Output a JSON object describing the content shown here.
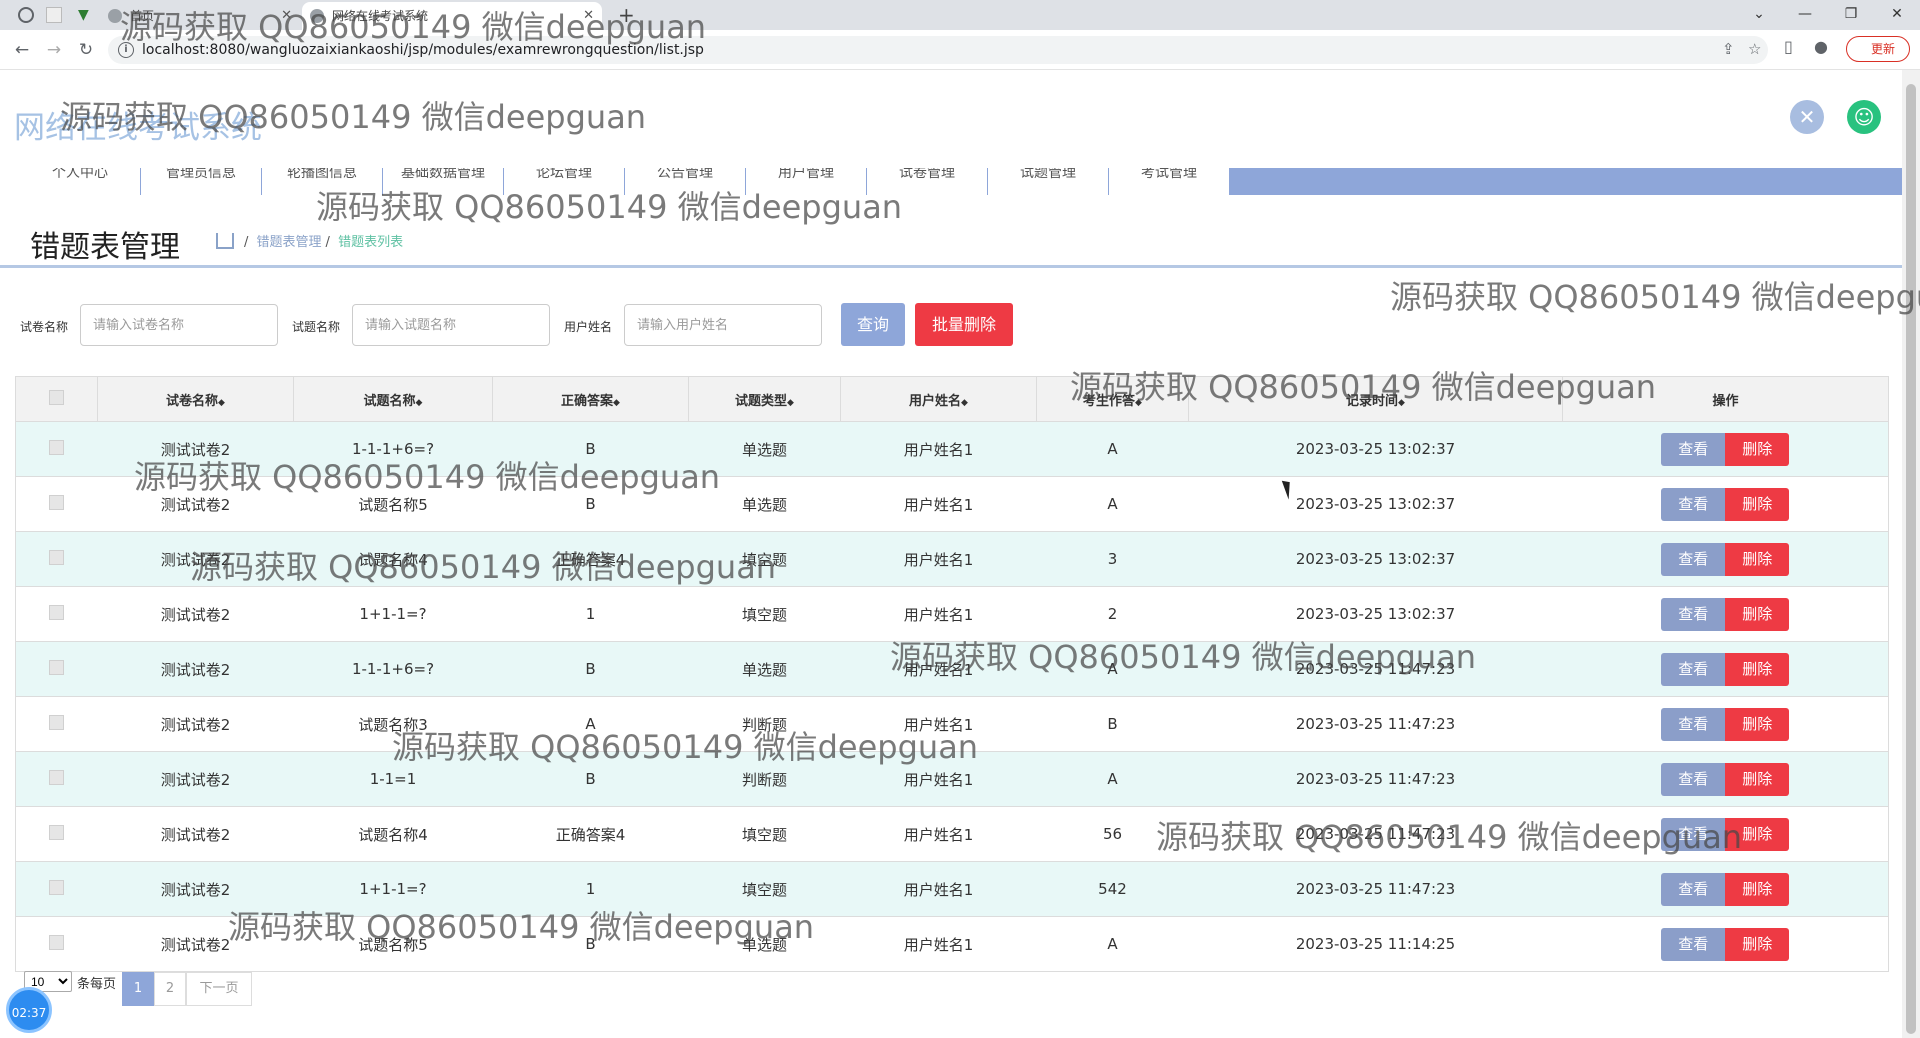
{
  "browser": {
    "tabs": [
      {
        "label": "首页"
      },
      {
        "label": "网络在线考试系统"
      }
    ],
    "url": "localhost:8080/wangluozaixiankaoshi/jsp/modules/examrewrongquestion/list.jsp",
    "update_label": "更新"
  },
  "app": {
    "title": "网络在线考试系统"
  },
  "navbar": {
    "items": [
      {
        "label": "个人中心"
      },
      {
        "label": "管理员信息"
      },
      {
        "label": "轮播图信息"
      },
      {
        "label": "基础数据管理"
      },
      {
        "label": "论坛管理"
      },
      {
        "label": "公告管理"
      },
      {
        "label": "用户管理"
      },
      {
        "label": "试卷管理"
      },
      {
        "label": "试题管理"
      },
      {
        "label": "考试管理"
      }
    ]
  },
  "page": {
    "title": "错题表管理",
    "crumb1": "错题表管理",
    "crumb2": "错题表列表"
  },
  "search": {
    "paper_label": "试卷名称",
    "paper_placeholder": "请输入试卷名称",
    "question_label": "试题名称",
    "question_placeholder": "请输入试题名称",
    "user_label": "用户姓名",
    "user_placeholder": "请输入用户姓名",
    "query_label": "查询",
    "batch_delete_label": "批量删除"
  },
  "table": {
    "headers": [
      "试卷名称",
      "试题名称",
      "正确答案",
      "试题类型",
      "用户姓名",
      "考生作答",
      "记录时间",
      "操作"
    ],
    "view_label": "查看",
    "delete_label": "删除",
    "rows": [
      {
        "paper": "测试试卷2",
        "question": "1-1-1+6=?",
        "answer": "B",
        "type": "单选题",
        "user": "用户姓名1",
        "response": "A",
        "time": "2023-03-25 13:02:37"
      },
      {
        "paper": "测试试卷2",
        "question": "试题名称5",
        "answer": "B",
        "type": "单选题",
        "user": "用户姓名1",
        "response": "A",
        "time": "2023-03-25 13:02:37"
      },
      {
        "paper": "测试试卷2",
        "question": "试题名称4",
        "answer": "正确答案4",
        "type": "填空题",
        "user": "用户姓名1",
        "response": "3",
        "time": "2023-03-25 13:02:37"
      },
      {
        "paper": "测试试卷2",
        "question": "1+1-1=?",
        "answer": "1",
        "type": "填空题",
        "user": "用户姓名1",
        "response": "2",
        "time": "2023-03-25 13:02:37"
      },
      {
        "paper": "测试试卷2",
        "question": "1-1-1+6=?",
        "answer": "B",
        "type": "单选题",
        "user": "用户姓名1",
        "response": "A",
        "time": "2023-03-25 11:47:23"
      },
      {
        "paper": "测试试卷2",
        "question": "试题名称3",
        "answer": "A",
        "type": "判断题",
        "user": "用户姓名1",
        "response": "B",
        "time": "2023-03-25 11:47:23"
      },
      {
        "paper": "测试试卷2",
        "question": "1-1=1",
        "answer": "B",
        "type": "判断题",
        "user": "用户姓名1",
        "response": "A",
        "time": "2023-03-25 11:47:23"
      },
      {
        "paper": "测试试卷2",
        "question": "试题名称4",
        "answer": "正确答案4",
        "type": "填空题",
        "user": "用户姓名1",
        "response": "56",
        "time": "2023-03-25 11:47:23"
      },
      {
        "paper": "测试试卷2",
        "question": "1+1-1=?",
        "answer": "1",
        "type": "填空题",
        "user": "用户姓名1",
        "response": "542",
        "time": "2023-03-25 11:47:23"
      },
      {
        "paper": "测试试卷2",
        "question": "试题名称5",
        "answer": "B",
        "type": "单选题",
        "user": "用户姓名1",
        "response": "A",
        "time": "2023-03-25 11:14:25"
      }
    ]
  },
  "pager": {
    "page_size": "10",
    "per_page_label": "条每页",
    "pages": [
      "1",
      "2"
    ],
    "next_label": "下一页"
  },
  "clock": "02:37",
  "watermark": "源码获取 QQ86050149 微信deepguan",
  "colors": {
    "primary": "#8ea6d9",
    "danger": "#ee3a44",
    "row_highlight": "#e8f8f7",
    "header_bg": "#f2f2f2"
  }
}
